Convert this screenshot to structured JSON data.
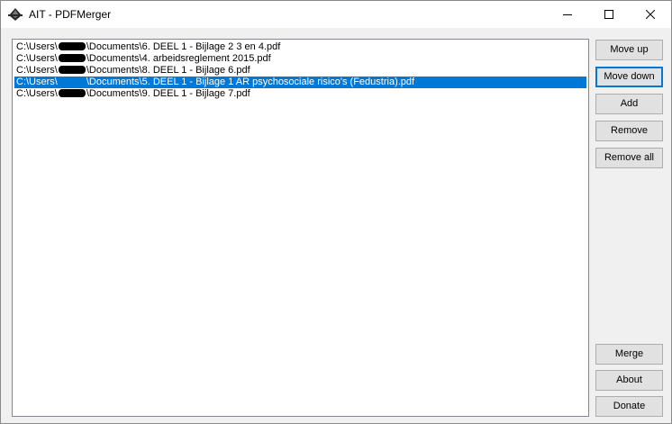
{
  "window": {
    "title": "AIT - PDFMerger"
  },
  "files": [
    {
      "prefix": "C:\\Users\\",
      "suffix": "\\Documents\\6. DEEL 1 - Bijlage 2 3 en 4.pdf"
    },
    {
      "prefix": "C:\\Users\\",
      "suffix": "\\Documents\\4. arbeidsreglement 2015.pdf"
    },
    {
      "prefix": "C:\\Users\\",
      "suffix": "\\Documents\\8. DEEL 1 - Bijlage 6.pdf"
    },
    {
      "prefix": "C:\\Users\\",
      "suffix": "\\Documents\\5. DEEL 1 - Bijlage 1 AR psychosociale risico's (Fedustria).pdf"
    },
    {
      "prefix": "C:\\Users\\",
      "suffix": "\\Documents\\9. DEEL 1 - Bijlage 7.pdf"
    }
  ],
  "selected_index": 3,
  "buttons": {
    "move_up": "Move up",
    "move_down": "Move down",
    "add": "Add",
    "remove": "Remove",
    "remove_all": "Remove all",
    "merge": "Merge",
    "about": "About",
    "donate": "Donate"
  },
  "colors": {
    "selection": "#0078d7",
    "focus_border": "#0078d7"
  }
}
